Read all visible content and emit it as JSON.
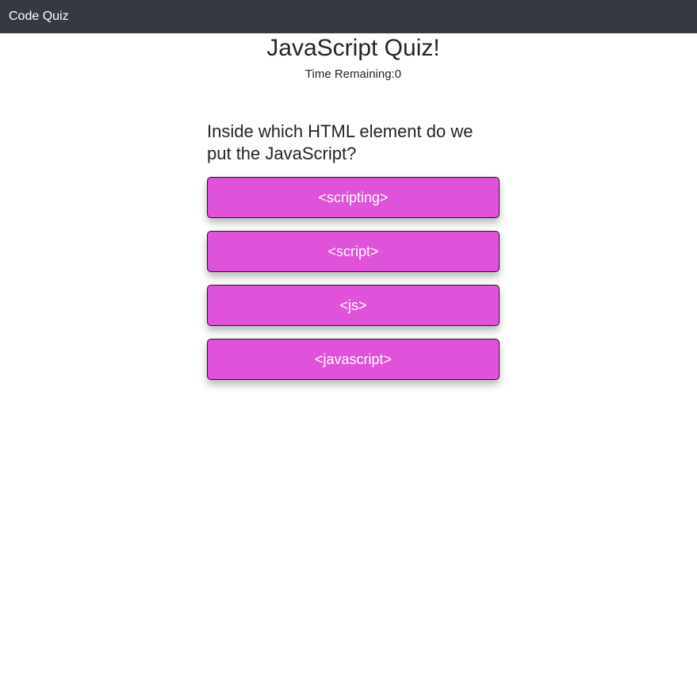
{
  "navbar": {
    "brand": "Code Quiz"
  },
  "header": {
    "title": "JavaScript Quiz!",
    "timer_label": "Time Remaining:0"
  },
  "quiz": {
    "question": "Inside which HTML element do we put the JavaScript?",
    "choices": [
      "<scripting>",
      "<script>",
      "<js>",
      "<javascript>"
    ]
  },
  "colors": {
    "navbar": "#343a40",
    "choice_button": "#e052d9"
  }
}
